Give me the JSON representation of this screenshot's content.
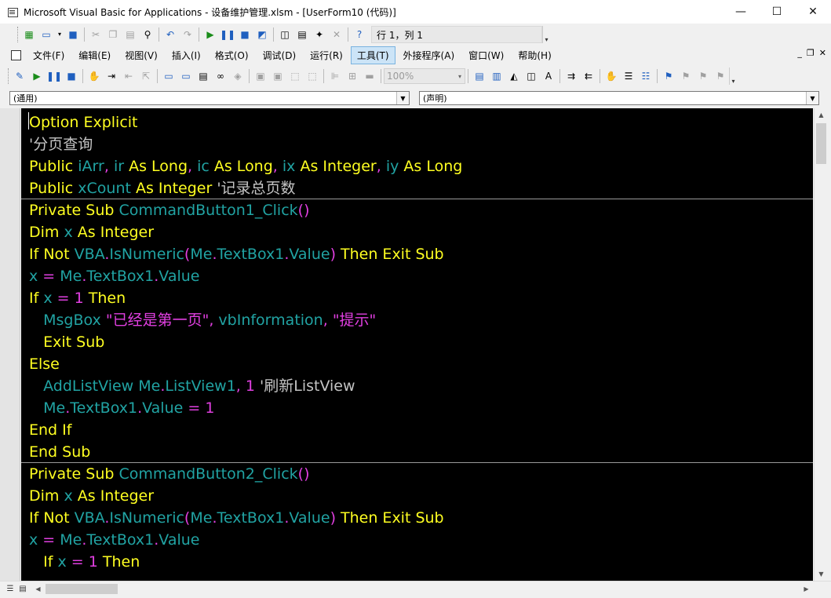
{
  "window": {
    "title": "Microsoft Visual Basic for Applications - 设备维护管理.xlsm - [UserForm10 (代码)]",
    "minimize": "—",
    "maximize": "☐",
    "close": "✕"
  },
  "toolbar_standard": {
    "cursor_position": "行 1，列 1",
    "icons": [
      "excel-view-icon",
      "insert-userform-icon",
      "save-icon",
      "cut-icon",
      "copy-icon",
      "paste-icon",
      "find-icon",
      "undo-icon",
      "redo-icon",
      "run-icon",
      "break-icon",
      "reset-icon",
      "design-mode-icon",
      "project-explorer-icon",
      "properties-icon",
      "object-browser-icon",
      "toolbox-icon",
      "help-icon"
    ]
  },
  "menu": {
    "items": [
      "文件(F)",
      "编辑(E)",
      "视图(V)",
      "插入(I)",
      "格式(O)",
      "调试(D)",
      "运行(R)",
      "工具(T)",
      "外接程序(A)",
      "窗口(W)",
      "帮助(H)"
    ],
    "active": "工具(T)",
    "mdi_minimize": "_",
    "mdi_restore": "❐",
    "mdi_close": "✕"
  },
  "toolbar_userform": {
    "zoom": "100%"
  },
  "code_window": {
    "object_combo": "(通用)",
    "procedure_combo": "(声明)"
  },
  "code_lines": [
    [
      [
        "kw",
        "Option Explicit"
      ]
    ],
    [
      [
        "cm",
        "'分页查询"
      ]
    ],
    [
      [
        "kw",
        "Public "
      ],
      [
        "id",
        "iArr"
      ],
      [
        "op",
        ", "
      ],
      [
        "id",
        "ir "
      ],
      [
        "kw",
        "As Long"
      ],
      [
        "op",
        ", "
      ],
      [
        "id",
        "ic "
      ],
      [
        "kw",
        "As Long"
      ],
      [
        "op",
        ", "
      ],
      [
        "id",
        "ix "
      ],
      [
        "kw",
        "As Integer"
      ],
      [
        "op",
        ", "
      ],
      [
        "id",
        "iy "
      ],
      [
        "kw",
        "As Long"
      ]
    ],
    [
      [
        "kw",
        "Public "
      ],
      [
        "id",
        "xCount "
      ],
      [
        "kw",
        "As Integer "
      ],
      [
        "cm",
        "'记录总页数"
      ]
    ],
    [
      [
        "kw",
        "Private Sub "
      ],
      [
        "id",
        "CommandButton1_Click"
      ],
      [
        "op",
        "()"
      ]
    ],
    [
      [
        "kw",
        "Dim "
      ],
      [
        "id",
        "x "
      ],
      [
        "kw",
        "As Integer"
      ]
    ],
    [
      [
        "kw",
        "If Not "
      ],
      [
        "id",
        "VBA"
      ],
      [
        "op",
        "."
      ],
      [
        "id",
        "IsNumeric"
      ],
      [
        "op",
        "("
      ],
      [
        "id",
        "Me"
      ],
      [
        "op",
        "."
      ],
      [
        "id",
        "TextBox1"
      ],
      [
        "op",
        "."
      ],
      [
        "id",
        "Value"
      ],
      [
        "op",
        ") "
      ],
      [
        "kw",
        "Then Exit Sub"
      ]
    ],
    [
      [
        "id",
        "x "
      ],
      [
        "op",
        "= "
      ],
      [
        "id",
        "Me"
      ],
      [
        "op",
        "."
      ],
      [
        "id",
        "TextBox1"
      ],
      [
        "op",
        "."
      ],
      [
        "id",
        "Value"
      ]
    ],
    [
      [
        "kw",
        "If "
      ],
      [
        "id",
        "x "
      ],
      [
        "op",
        "= "
      ],
      [
        "num",
        "1 "
      ],
      [
        "kw",
        "Then"
      ]
    ],
    [
      [
        "id",
        "   MsgBox "
      ],
      [
        "str",
        "\"已经是第一页\""
      ],
      [
        "op",
        ", "
      ],
      [
        "id",
        "vbInformation"
      ],
      [
        "op",
        ", "
      ],
      [
        "str",
        "\"提示\""
      ]
    ],
    [
      [
        "kw",
        "   Exit Sub"
      ]
    ],
    [
      [
        "kw",
        "Else"
      ]
    ],
    [
      [
        "id",
        "   AddListView "
      ],
      [
        "id",
        "Me"
      ],
      [
        "op",
        "."
      ],
      [
        "id",
        "ListView1"
      ],
      [
        "op",
        ", "
      ],
      [
        "num",
        "1 "
      ],
      [
        "cm",
        "'刷新ListView"
      ]
    ],
    [
      [
        "id",
        "   Me"
      ],
      [
        "op",
        "."
      ],
      [
        "id",
        "TextBox1"
      ],
      [
        "op",
        "."
      ],
      [
        "id",
        "Value "
      ],
      [
        "op",
        "= "
      ],
      [
        "num",
        "1"
      ]
    ],
    [
      [
        "kw",
        "End If"
      ]
    ],
    [
      [
        "kw",
        "End Sub"
      ]
    ],
    [
      [
        "kw",
        "Private Sub "
      ],
      [
        "id",
        "CommandButton2_Click"
      ],
      [
        "op",
        "()"
      ]
    ],
    [
      [
        "kw",
        "Dim "
      ],
      [
        "id",
        "x "
      ],
      [
        "kw",
        "As Integer"
      ]
    ],
    [
      [
        "kw",
        "If Not "
      ],
      [
        "id",
        "VBA"
      ],
      [
        "op",
        "."
      ],
      [
        "id",
        "IsNumeric"
      ],
      [
        "op",
        "("
      ],
      [
        "id",
        "Me"
      ],
      [
        "op",
        "."
      ],
      [
        "id",
        "TextBox1"
      ],
      [
        "op",
        "."
      ],
      [
        "id",
        "Value"
      ],
      [
        "op",
        ") "
      ],
      [
        "kw",
        "Then Exit Sub"
      ]
    ],
    [
      [
        "id",
        "x "
      ],
      [
        "op",
        "= "
      ],
      [
        "id",
        "Me"
      ],
      [
        "op",
        "."
      ],
      [
        "id",
        "TextBox1"
      ],
      [
        "op",
        "."
      ],
      [
        "id",
        "Value"
      ]
    ],
    [
      [
        "kw",
        "   If "
      ],
      [
        "id",
        "x "
      ],
      [
        "op",
        "= "
      ],
      [
        "num",
        "1 "
      ],
      [
        "kw",
        "Then"
      ]
    ]
  ],
  "colors": {
    "keyword": "#ffff21",
    "identifier": "#21a3a3",
    "operator": "#e13fe1",
    "comment": "#c4c4c4",
    "background": "#000000"
  }
}
